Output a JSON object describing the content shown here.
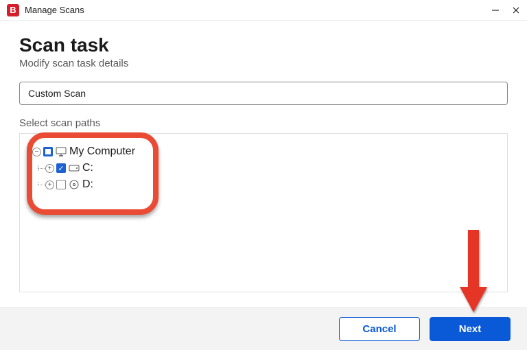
{
  "window": {
    "app_badge": "B",
    "title": "Manage Scans"
  },
  "page": {
    "title": "Scan task",
    "subtitle": "Modify scan task details",
    "scan_name": "Custom Scan",
    "section_label": "Select scan paths"
  },
  "tree": {
    "root": {
      "label": "My Computer",
      "expanded": true,
      "check_state": "partial",
      "children": [
        {
          "label": "C:",
          "check_state": "checked",
          "expanded": false,
          "icon": "drive"
        },
        {
          "label": "D:",
          "check_state": "unchecked",
          "expanded": false,
          "icon": "disc"
        }
      ]
    }
  },
  "footer": {
    "cancel": "Cancel",
    "next": "Next"
  }
}
